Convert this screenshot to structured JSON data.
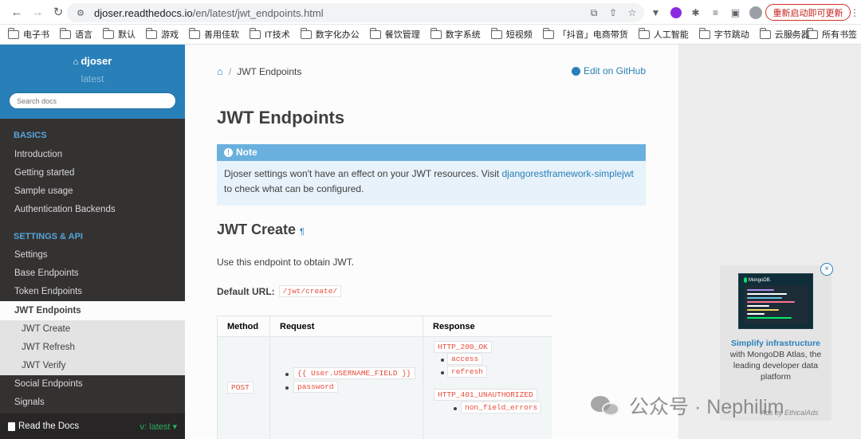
{
  "browser": {
    "url_host": "djoser.readthedocs.io",
    "url_path": "/en/latest/jwt_endpoints.html",
    "restart_label": "重新启动即可更新",
    "bookmarks": [
      "电子书",
      "语言",
      "默认",
      "游戏",
      "善用佳软",
      "IT技术",
      "数字化办公",
      "餐饮管理",
      "数字系统",
      "短视频",
      "「抖音」电商带货",
      "人工智能",
      "字节跳动",
      "云服务器"
    ],
    "bookmarks_more": "»",
    "all_bookmarks": "所有书签"
  },
  "sidebar": {
    "project": "djoser",
    "version": "latest",
    "search_placeholder": "Search docs",
    "captions": [
      "BASICS",
      "SETTINGS & API"
    ],
    "basics": [
      "Introduction",
      "Getting started",
      "Sample usage",
      "Authentication Backends"
    ],
    "api": [
      "Settings",
      "Base Endpoints",
      "Token Endpoints",
      "JWT Endpoints"
    ],
    "sub_items": [
      "JWT Create",
      "JWT Refresh",
      "JWT Verify"
    ],
    "after": [
      "Social Endpoints",
      "Signals"
    ],
    "rtd_label": "Read the Docs",
    "rtd_version": "v: latest ▾"
  },
  "content": {
    "breadcrumb_current": "JWT Endpoints",
    "edit_github": "Edit on GitHub",
    "title": "JWT Endpoints",
    "note_title": "Note",
    "note_text_1": "Djoser settings won't have an effect on your JWT resources. Visit ",
    "note_link": "djangorestframework-simplejwt",
    "note_text_2": " to check what can be configured.",
    "section_title": "JWT Create",
    "pilcrow": "¶",
    "intro": "Use this endpoint to obtain JWT.",
    "default_url_label": "Default URL:",
    "default_url": "/jwt/create/",
    "table": {
      "headers": [
        "Method",
        "Request",
        "Response"
      ],
      "method": "POST",
      "request": [
        "{{ User.USERNAME_FIELD }}",
        "password"
      ],
      "response_ok": "HTTP_200_OK",
      "response_ok_items": [
        "access",
        "refresh"
      ],
      "response_unauth": "HTTP_401_UNAUTHORIZED",
      "response_unauth_items": [
        "non_field_errors"
      ]
    }
  },
  "ad": {
    "brand": "MongoDB.",
    "link_text": "Simplify infrastructure",
    "text": " with MongoDB Atlas, the leading developer data platform",
    "by": "Ads by EthicalAds",
    "close": "×"
  },
  "watermark": "公众号 · Nephilim"
}
